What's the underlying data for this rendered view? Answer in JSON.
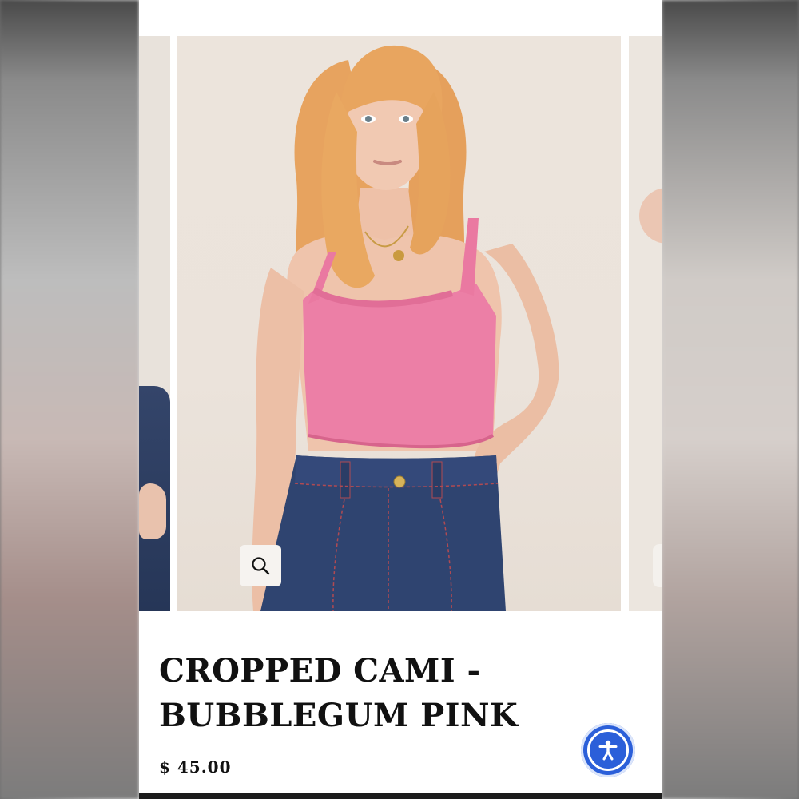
{
  "product": {
    "title_line1": "CROPPED CAMI -",
    "title_line2": "BUBBLEGUM PINK",
    "price": "$ 45.00"
  },
  "gallery": {
    "zoom_icon": "magnifier-icon",
    "accessibility_icon": "accessibility-icon"
  },
  "colors": {
    "accessibility_button": "#2b5fd9",
    "cami": "#ec7fa6",
    "denim": "#2f4470"
  }
}
